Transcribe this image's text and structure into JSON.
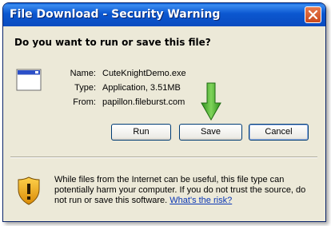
{
  "window": {
    "title": "File Download - Security Warning"
  },
  "question": "Do you want to run or save this file?",
  "file": {
    "name_label": "Name:",
    "name_value": "CuteKnightDemo.exe",
    "type_label": "Type:",
    "type_value": "Application, 3.51MB",
    "from_label": "From:",
    "from_value": "papillon.fileburst.com"
  },
  "buttons": {
    "run": "Run",
    "save": "Save",
    "cancel": "Cancel"
  },
  "warning": {
    "text": "While files from the Internet can be useful, this file type can potentially harm your computer. If you do not trust the source, do not run or save this software. ",
    "link": "What's the risk?"
  },
  "icons": {
    "close": "close-icon",
    "file": "application-window-icon",
    "arrow": "green-arrow-icon",
    "shield": "security-shield-icon"
  },
  "colors": {
    "titlebar": "#0b57d0",
    "dialog_bg": "#ece9d8",
    "link": "#0b37b5",
    "arrow": "#3aa626",
    "shield": "#e8a416"
  }
}
